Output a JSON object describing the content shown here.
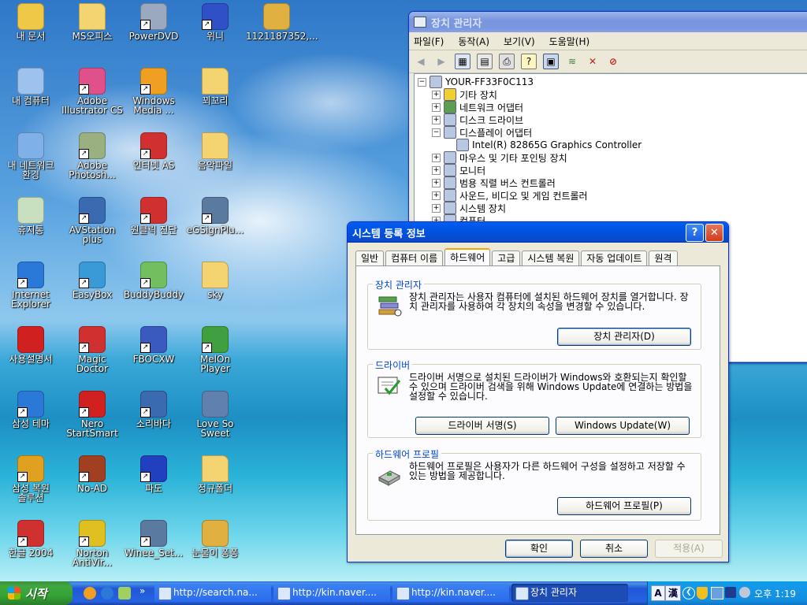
{
  "desktop": {
    "icons": [
      {
        "label": "내 문서",
        "icon": "my-documents-icon",
        "color": "#f0c848"
      },
      {
        "label": "MS오피스",
        "icon": "folder-icon",
        "color": "#f3d470"
      },
      {
        "label": "PowerDVD",
        "icon": "powerdvd-icon",
        "color": "#9aa9c0"
      },
      {
        "label": "위니",
        "icon": "wini-icon",
        "color": "#3050c8"
      },
      {
        "label": "1121187352,...",
        "icon": "wma-file-icon",
        "color": "#e0b040"
      },
      {
        "label": "내 컴퓨터",
        "icon": "my-computer-icon",
        "color": "#9ec2ee"
      },
      {
        "label": "Adobe Illustrator CS",
        "icon": "illustrator-icon",
        "color": "#e0508a"
      },
      {
        "label": "Windows Media ...",
        "icon": "windows-media-icon",
        "color": "#f0a020"
      },
      {
        "label": "꾀꼬리",
        "icon": "folder-icon",
        "color": "#f3d470"
      },
      {
        "label": "내 네트워크 환경",
        "icon": "network-icon",
        "color": "#7fb0e8"
      },
      {
        "label": "Adobe Photosh...",
        "icon": "photoshop-icon",
        "color": "#9ab080"
      },
      {
        "label": "인터넷 AS",
        "icon": "internet-as-icon",
        "color": "#d03030"
      },
      {
        "label": "음악파일",
        "icon": "folder-icon",
        "color": "#f3d470"
      },
      {
        "label": "휴지통",
        "icon": "recycle-bin-icon",
        "color": "#c8e0c0"
      },
      {
        "label": "AVStation plus",
        "icon": "avstation-icon",
        "color": "#3a6ab0"
      },
      {
        "label": "원클릭 진단",
        "icon": "one-click-icon",
        "color": "#d03030"
      },
      {
        "label": "eGSignPlu...",
        "icon": "egsign-icon",
        "color": "#5a7aa0"
      },
      {
        "label": "Internet Explorer",
        "icon": "internet-explorer-icon",
        "color": "#2a78d8"
      },
      {
        "label": "EasyBox",
        "icon": "easybox-icon",
        "color": "#3a9ad8"
      },
      {
        "label": "BuddyBuddy",
        "icon": "buddybuddy-icon",
        "color": "#70c060"
      },
      {
        "label": "sky",
        "icon": "folder-icon",
        "color": "#f3d470"
      },
      {
        "label": "사용설명서",
        "icon": "pdf-icon",
        "color": "#d02020"
      },
      {
        "label": "Magic Doctor",
        "icon": "magic-doctor-icon",
        "color": "#d03030"
      },
      {
        "label": "FBOCXW",
        "icon": "fbocxw-icon",
        "color": "#3a5ac0"
      },
      {
        "label": "MelOn Player",
        "icon": "melon-player-icon",
        "color": "#40a040"
      },
      {
        "label": "삼성 테마",
        "icon": "samsung-theme-icon",
        "color": "#2a78d8"
      },
      {
        "label": "Nero StartSmart",
        "icon": "nero-icon",
        "color": "#d02020"
      },
      {
        "label": "소리바다",
        "icon": "soribada-icon",
        "color": "#3a6ab0"
      },
      {
        "label": "Love So Sweet",
        "icon": "mp3-file-icon",
        "color": "#6080b0"
      },
      {
        "label": "삼성 복원 솔루션",
        "icon": "samsung-recovery-icon",
        "color": "#e0a020"
      },
      {
        "label": "No-AD",
        "icon": "no-ad-icon",
        "color": "#a04020"
      },
      {
        "label": "파도",
        "icon": "pado-icon",
        "color": "#2040c0"
      },
      {
        "label": "정규폴더",
        "icon": "folder-icon",
        "color": "#f3d470"
      },
      {
        "label": "한글 2004",
        "icon": "hangul-icon",
        "color": "#d03030"
      },
      {
        "label": "Norton AntiVir...",
        "icon": "norton-icon",
        "color": "#e0c020"
      },
      {
        "label": "Winee_Set...",
        "icon": "winee-set-icon",
        "color": "#5a7aa0"
      },
      {
        "label": "눈물이 퐁퐁",
        "icon": "wma-file-icon",
        "color": "#e0b040"
      }
    ]
  },
  "device_manager": {
    "title": "장치 관리자",
    "menu": [
      "파일(F)",
      "동작(A)",
      "보기(V)",
      "도움말(H)"
    ],
    "toolbar": [
      "back-icon",
      "forward-icon",
      "properties-view-icon",
      "properties-icon",
      "print-icon",
      "help-icon",
      "scan-icon",
      "update-driver-icon",
      "uninstall-icon",
      "disable-icon"
    ],
    "tree": [
      {
        "label": "YOUR-FF33F0C113",
        "level": 0,
        "expander": "−",
        "icon": "computer-icon"
      },
      {
        "label": "기타 장치",
        "level": 1,
        "expander": "+",
        "icon": "unknown-device-icon"
      },
      {
        "label": "네트워크 어댑터",
        "level": 1,
        "expander": "+",
        "icon": "network-adapter-icon"
      },
      {
        "label": "디스크 드라이브",
        "level": 1,
        "expander": "+",
        "icon": "disk-drive-icon"
      },
      {
        "label": "디스플레이 어댑터",
        "level": 1,
        "expander": "−",
        "icon": "display-adapter-icon"
      },
      {
        "label": "Intel(R) 82865G Graphics Controller",
        "level": 2,
        "expander": "",
        "icon": "display-adapter-icon"
      },
      {
        "label": "마우스 및 기타 포인팅 장치",
        "level": 1,
        "expander": "+",
        "icon": "mouse-icon"
      },
      {
        "label": "모니터",
        "level": 1,
        "expander": "+",
        "icon": "monitor-icon"
      },
      {
        "label": "범용 직렬 버스 컨트롤러",
        "level": 1,
        "expander": "+",
        "icon": "usb-icon"
      },
      {
        "label": "사운드, 비디오 및 게임 컨트롤러",
        "level": 1,
        "expander": "+",
        "icon": "sound-icon"
      },
      {
        "label": "시스템 장치",
        "level": 1,
        "expander": "+",
        "icon": "system-device-icon"
      },
      {
        "label": "컴퓨터",
        "level": 1,
        "expander": "+",
        "icon": "computer-icon"
      }
    ]
  },
  "dialog": {
    "title": "시스템 등록 정보",
    "help_label": "?",
    "close_label": "✕",
    "tabs": [
      "일반",
      "컴퓨터 이름",
      "하드웨어",
      "고급",
      "시스템 복원",
      "자동 업데이트",
      "원격"
    ],
    "selected_tab": "하드웨어",
    "groups": {
      "device_manager": {
        "title": "장치 관리자",
        "text": "장치 관리자는 사용자 컴퓨터에 설치된 하드웨어 장치를 열거합니다. 장치 관리자를 사용하여 각 장치의 속성을 변경할 수 있습니다.",
        "button": "장치 관리자(D)"
      },
      "driver": {
        "title": "드라이버",
        "text": "드라이버 서명으로 설치된 드라이버가 Windows와 호환되는지 확인할 수 있으며 드라이버 검색을 위해 Windows Update에 연결하는 방법을 설정할 수 있습니다.",
        "button_sign": "드라이버 서명(S)",
        "button_update": "Windows Update(W)"
      },
      "profile": {
        "title": "하드웨어 프로필",
        "text": "하드웨어 프로필은 사용자가 다른 하드웨어 구성을 설정하고 저장할 수 있는 방법을 제공합니다.",
        "button": "하드웨어 프로필(P)"
      }
    },
    "ok_label": "확인",
    "cancel_label": "취소",
    "apply_label": "적용(A)"
  },
  "taskbar": {
    "start_label": "시작",
    "chevron": "»",
    "tasks": [
      {
        "label": "http://search.na...",
        "active": false
      },
      {
        "label": "http://kin.naver....",
        "active": false
      },
      {
        "label": "http://kin.naver....",
        "active": false
      },
      {
        "label": "장치 관리자",
        "active": true
      }
    ],
    "ime_a": "A",
    "ime_han": "漢",
    "clock": "오후 1:19"
  },
  "colors": {
    "xp_blue": "#0058ee",
    "dialog_bg": "#ece9d8",
    "close_red": "#e04b2a",
    "group_title": "#0046d5"
  }
}
